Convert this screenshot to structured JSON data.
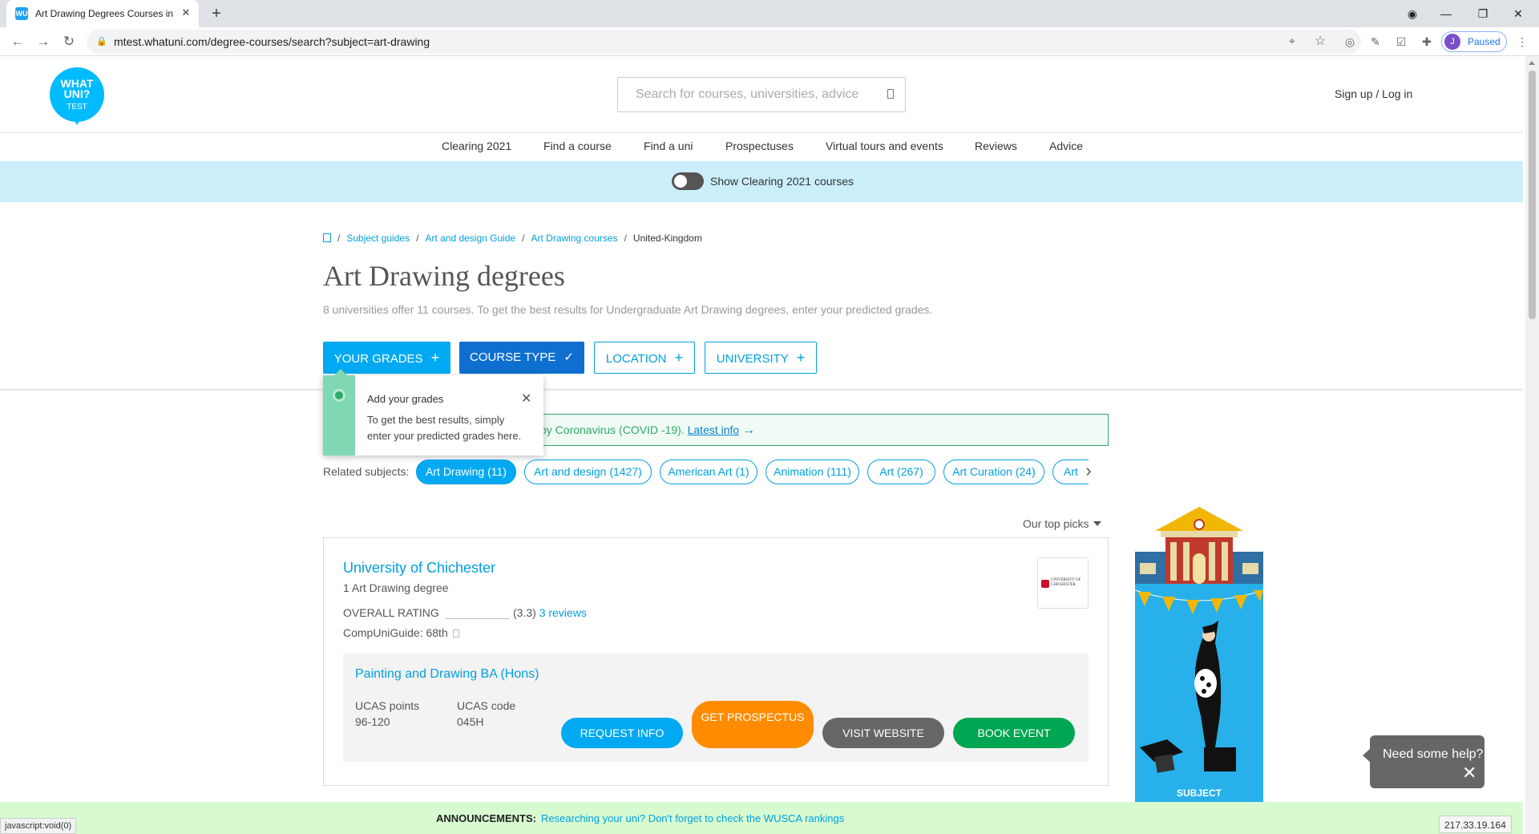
{
  "browser": {
    "tab_title": "Art Drawing Degrees Courses in UK",
    "tab_favicon": "WU",
    "url": "mtest.whatuni.com/degree-courses/search?subject=art-drawing",
    "profile_initial": "J",
    "profile_status": "Paused"
  },
  "header": {
    "logo_line1": "WHAT UNI?",
    "logo_line2": "TEST",
    "search_placeholder": "Search for courses, universities, advice",
    "signup": "Sign up / Log in"
  },
  "nav": {
    "items": [
      "Clearing 2021",
      "Find a course",
      "Find a uni",
      "Prospectuses",
      "Virtual tours and events",
      "Reviews",
      "Advice"
    ]
  },
  "clearing_bar": {
    "label": "Show Clearing 2021 courses"
  },
  "breadcrumb": [
    "Subject guides",
    "Art and design Guide",
    "Art Drawing courses",
    "United-Kingdom"
  ],
  "page": {
    "title": "Art Drawing degrees",
    "subtitle": "8 universities offer 11 courses. To get the best results for Undergraduate Art Drawing degrees, enter your predicted grades."
  },
  "filters": [
    {
      "label": "YOUR GRADES",
      "icon": "+"
    },
    {
      "label": "COURSE TYPE",
      "icon": "✓"
    },
    {
      "label": "LOCATION",
      "icon": "+"
    },
    {
      "label": "UNIVERSITY",
      "icon": "+"
    }
  ],
  "tooltip": {
    "title": "Add your grades",
    "body": "To get the best results, simply enter your predicted grades here.",
    "close": "✕"
  },
  "notice": {
    "text": "by Coronavirus (COVID -19).",
    "link": "Latest info"
  },
  "related": {
    "label": "Related subjects:",
    "pills": [
      "Art Drawing (11)",
      "Art and design (1427)",
      "American Art (1)",
      "Animation (111)",
      "Art (267)",
      "Art Curation (24)",
      "Art"
    ]
  },
  "sort": {
    "label": "Our top picks"
  },
  "result": {
    "uni_name": "University of Chichester",
    "degree_count": "1 Art Drawing degree",
    "rating_label": "OVERALL RATING",
    "rating_value": "(3.3)",
    "reviews": "3 reviews",
    "rating": 3.3,
    "comp_uni": "CompUniGuide: 68th",
    "logo_text": "UNIVERSITY OF CHICHESTER",
    "course_name": "Painting and Drawing BA (Hons)",
    "ucas_points_label": "UCAS points",
    "ucas_points": "96-120",
    "ucas_code_label": "UCAS code",
    "ucas_code": "045H",
    "buttons": {
      "request": "REQUEST INFO",
      "prospectus": "GET PROSPECTUS",
      "visit": "VISIT WEBSITE",
      "book": "BOOK EVENT"
    }
  },
  "ad": {
    "text": "SUBJECT"
  },
  "help": {
    "label": "Need some help?",
    "close": "✕"
  },
  "announcement": {
    "label": "ANNOUNCEMENTS:",
    "message": "Researching your uni? Don't forget to check the WUSCA rankings"
  },
  "status_bar": {
    "url": "javascript:void(0)",
    "ip": "217.33.19.164"
  },
  "colors": {
    "brand": "#00bbfd",
    "accent": "#00a9f2",
    "prospectus": "#ff8c00",
    "book": "#00a651"
  }
}
